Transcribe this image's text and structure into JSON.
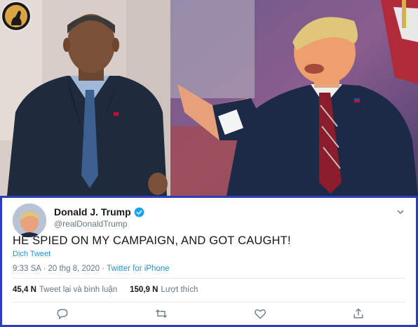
{
  "tweet": {
    "display_name": "Donald J. Trump",
    "handle": "@realDonaldTrump",
    "text": "HE SPIED ON MY CAMPAIGN, AND GOT CAUGHT!",
    "translate_label": "Dịch Tweet",
    "time": "9:33 SA · 20 thg 8, 2020 · ",
    "source": "Twitter for iPhone",
    "retweets_count": "45,4 N",
    "retweets_label": "Tweet lại và bình luận",
    "likes_count": "150,9 N",
    "likes_label": "Lượt thích",
    "actions": [
      "reply-icon",
      "retweet-icon",
      "like-icon",
      "share-icon"
    ],
    "verified_color": "#1da1f2"
  },
  "colors": {
    "frame_border": "#2b3fbd",
    "link": "#1b95e0"
  }
}
